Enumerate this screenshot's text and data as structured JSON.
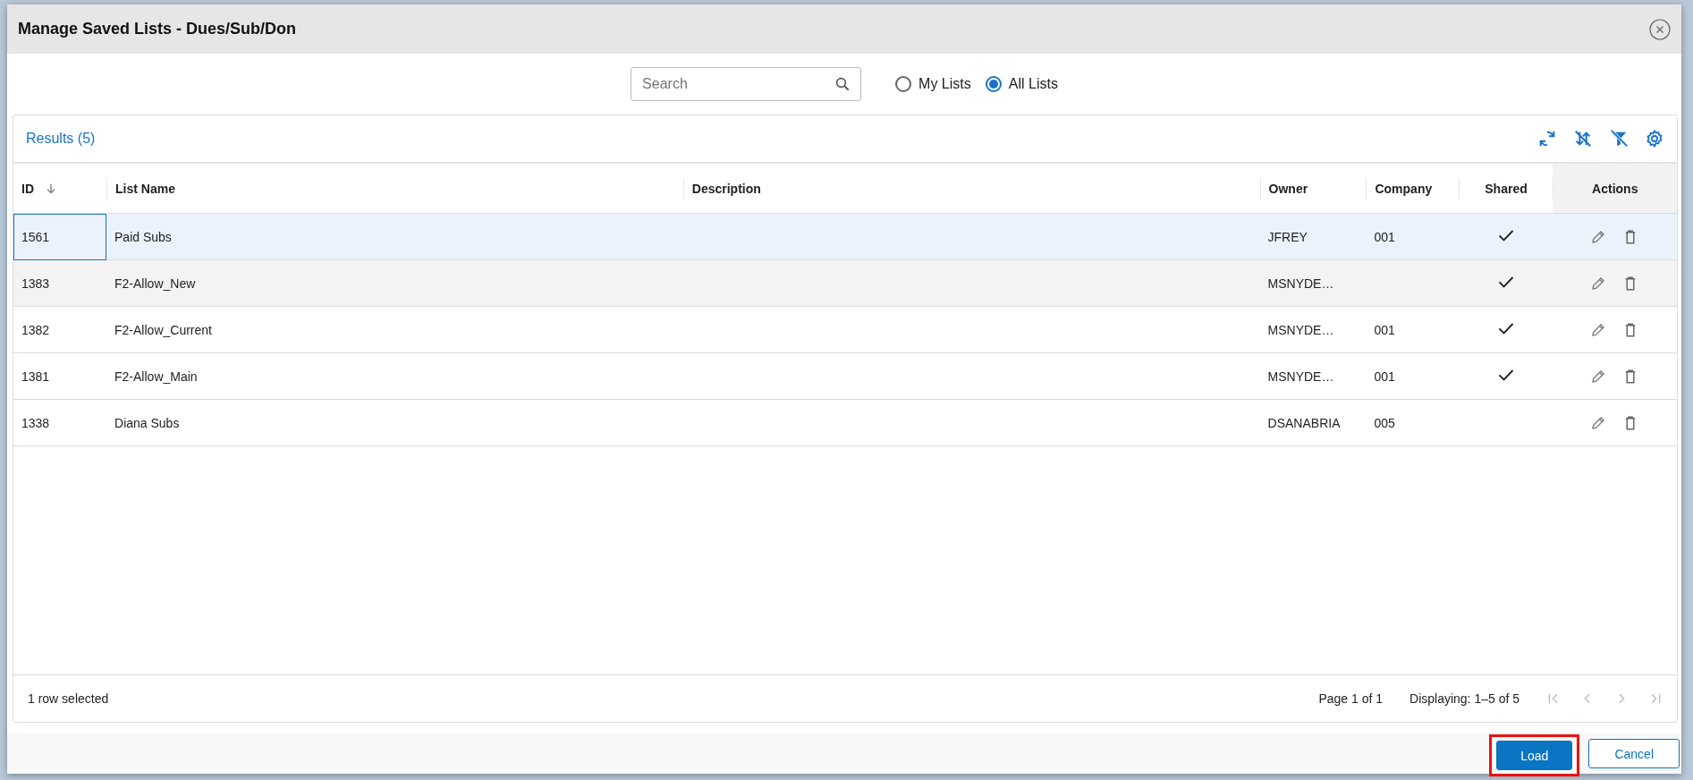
{
  "dialog": {
    "title": "Manage Saved Lists - Dues/Sub/Don"
  },
  "search": {
    "placeholder": "Search"
  },
  "scope": [
    {
      "label": "My Lists",
      "selected": false
    },
    {
      "label": "All Lists",
      "selected": true
    }
  ],
  "results": {
    "title": "Results (5)"
  },
  "table": {
    "columns": [
      {
        "label": "ID",
        "sorted": true
      },
      {
        "label": "List Name",
        "sorted": false
      },
      {
        "label": "Description",
        "sorted": false
      },
      {
        "label": "Owner",
        "sorted": false
      },
      {
        "label": "Company",
        "sorted": false
      },
      {
        "label": "Shared",
        "sorted": false
      },
      {
        "label": "Actions",
        "sorted": false
      }
    ],
    "rows": [
      {
        "id": "1561",
        "name": "Paid Subs",
        "description": "",
        "owner": "JFREY",
        "company": "001",
        "shared": true,
        "selected": true,
        "hovered": false
      },
      {
        "id": "1383",
        "name": "F2-Allow_New",
        "owner": "MSNYDE…",
        "company": "",
        "shared": true,
        "selected": false,
        "hovered": true
      },
      {
        "id": "1382",
        "name": "F2-Allow_Current",
        "owner": "MSNYDE…",
        "company": "001",
        "shared": true,
        "selected": false,
        "hovered": false
      },
      {
        "id": "1381",
        "name": "F2-Allow_Main",
        "owner": "MSNYDE…",
        "company": "001",
        "shared": true,
        "selected": false,
        "hovered": false
      },
      {
        "id": "1338",
        "name": "Diana Subs",
        "owner": "DSANABRIA",
        "company": "005",
        "shared": false,
        "selected": false,
        "hovered": false
      }
    ]
  },
  "status": {
    "selection": "1 row selected",
    "page": "Page 1 of 1",
    "displaying": "Displaying: 1–5 of 5"
  },
  "buttons": [
    {
      "label": "Load",
      "kind": "primary",
      "highlighted": true
    },
    {
      "label": "Cancel",
      "kind": "secondary",
      "highlighted": false
    }
  ]
}
